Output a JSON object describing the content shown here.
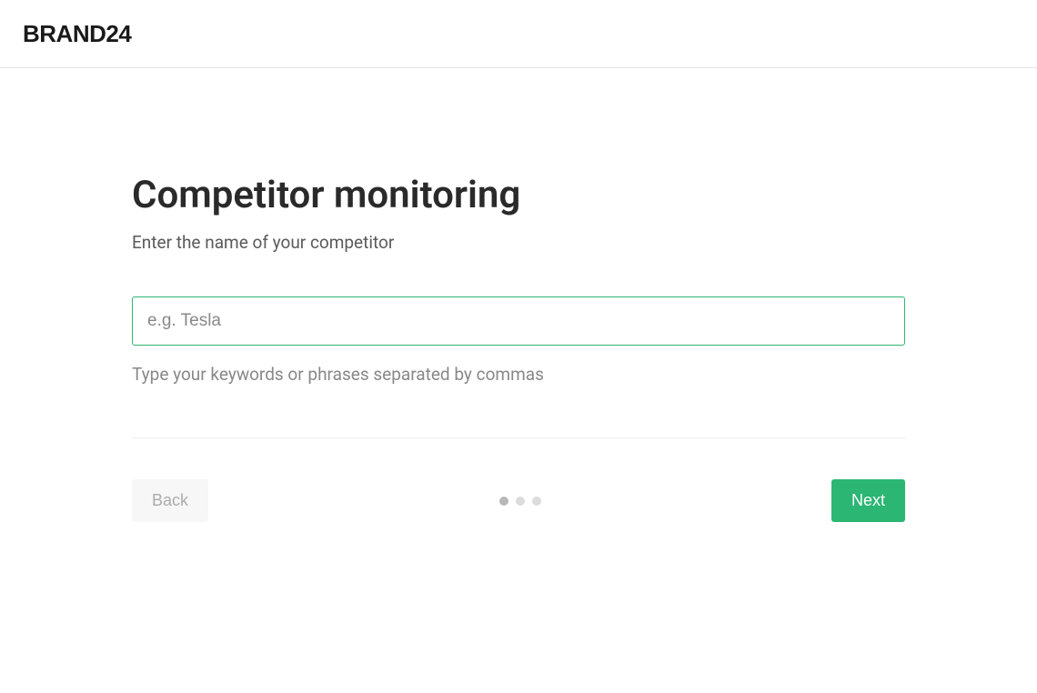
{
  "header": {
    "logo_text": "BRAND24"
  },
  "main": {
    "title": "Competitor monitoring",
    "subtitle": "Enter the name of your competitor",
    "input": {
      "value": "",
      "placeholder": "e.g. Tesla"
    },
    "helper_text": "Type your keywords or phrases separated by commas"
  },
  "footer": {
    "back_label": "Back",
    "next_label": "Next",
    "progress": {
      "total_steps": 3,
      "current_step": 1
    }
  },
  "colors": {
    "accent": "#2bb673"
  }
}
